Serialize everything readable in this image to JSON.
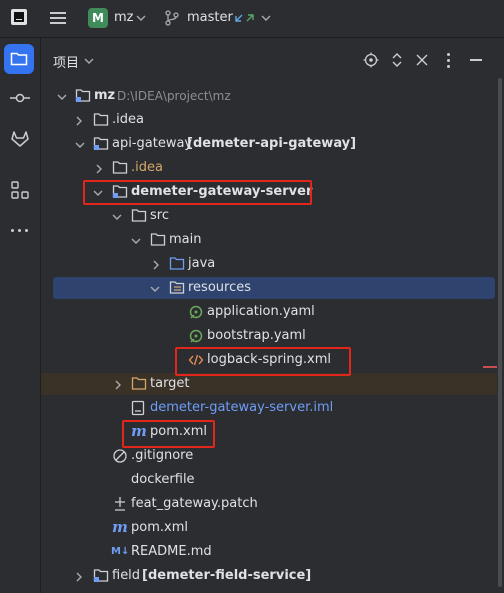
{
  "topbar": {
    "project_badge": "M",
    "project_name": "mz",
    "branch": "master"
  },
  "panel": {
    "title": "项目"
  },
  "tree": [
    {
      "label": "mz",
      "extra": "D:\\IDEA\\project\\mz"
    },
    {
      "label": ".idea"
    },
    {
      "label": "api-gateway",
      "extra": "[demeter-api-gateway]"
    },
    {
      "label": ".idea"
    },
    {
      "label": "demeter-gateway-server"
    },
    {
      "label": "src"
    },
    {
      "label": "main"
    },
    {
      "label": "java"
    },
    {
      "label": "resources"
    },
    {
      "label": "application.yaml"
    },
    {
      "label": "bootstrap.yaml"
    },
    {
      "label": "logback-spring.xml"
    },
    {
      "label": "target"
    },
    {
      "label": "demeter-gateway-server.iml"
    },
    {
      "label": "pom.xml"
    },
    {
      "label": ".gitignore"
    },
    {
      "label": "dockerfile"
    },
    {
      "label": "feat_gateway.patch"
    },
    {
      "label": "pom.xml"
    },
    {
      "label": "README.md"
    },
    {
      "label": "field",
      "extra": "[demeter-field-service]"
    }
  ],
  "icons": {
    "app_logo": "intellij-logo-icon",
    "menu": "hamburger-menu-icon",
    "branch": "git-branch-icon",
    "project_tool": "folder-icon",
    "commit_tool": "commit-icon",
    "gitlab_tool": "gitlab-icon",
    "structure_tool": "structure-icon",
    "more_tools": "more-icon",
    "locate": "locate-icon",
    "expand_collapse": "expand-collapse-icon",
    "close": "close-icon",
    "options": "options-icon",
    "minimize": "minimize-icon"
  },
  "colors": {
    "background": "#2b2d30",
    "selection": "#2e436e",
    "highlight_row": "#3a3127",
    "annotation_box": "#e2261c",
    "badge": "#3f8b59",
    "module_blue": "#6f9df5",
    "excluded_orange": "#d5a86a"
  }
}
